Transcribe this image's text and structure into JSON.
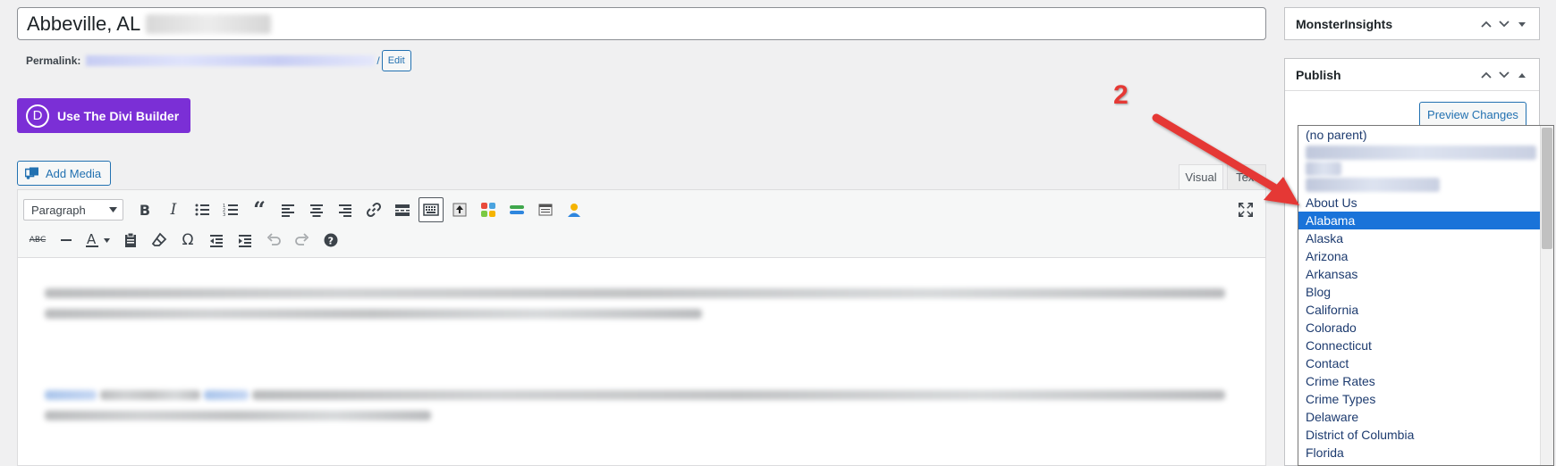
{
  "title": {
    "value": "Abbeville, AL"
  },
  "permalink": {
    "label": "Permalink:",
    "slash": "/",
    "edit_label": "Edit"
  },
  "divi": {
    "logo_letter": "D",
    "label": "Use The Divi Builder"
  },
  "media": {
    "add_label": "Add Media"
  },
  "editor_tabs": {
    "visual": "Visual",
    "text": "Text"
  },
  "toolbar": {
    "format_select": "Paragraph"
  },
  "sidebar": {
    "monsterinsights_title": "MonsterInsights",
    "publish_title": "Publish",
    "preview_label": "Preview Changes"
  },
  "parent_dropdown": {
    "options": [
      "(no parent)",
      "About Us",
      "Alabama",
      "Alaska",
      "Arizona",
      "Arkansas",
      "Blog",
      "California",
      "Colorado",
      "Connecticut",
      "Contact",
      "Crime Rates",
      "Crime Types",
      "Delaware",
      "District of Columbia",
      "Florida"
    ],
    "selected": "Alabama"
  },
  "annotation": {
    "number": "2"
  },
  "colors": {
    "divi_purple": "#7b2fd6",
    "wp_blue": "#2271b1",
    "selection_blue": "#1a73d9",
    "annotation_red": "#e53935"
  }
}
